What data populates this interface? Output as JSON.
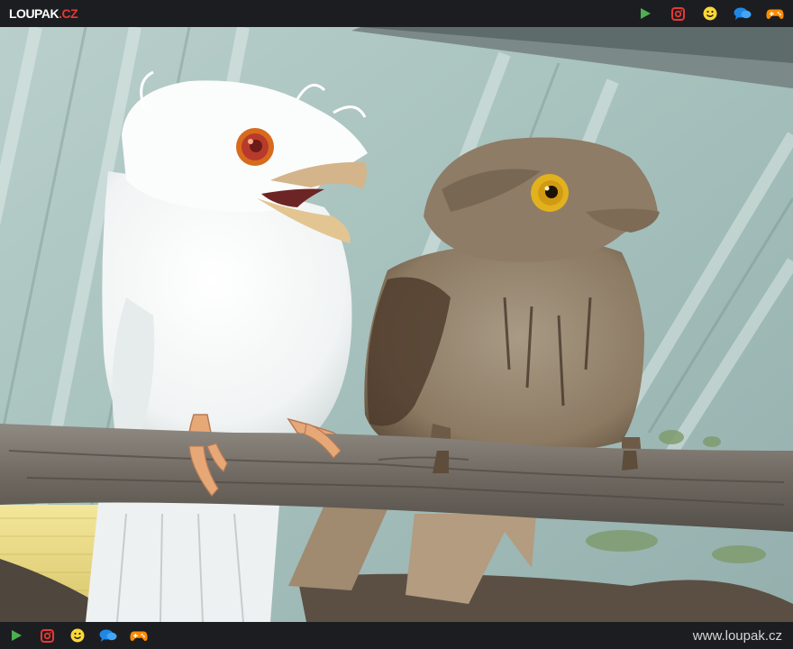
{
  "header": {
    "logo_text": "LOUPAK",
    "logo_tld": ".CZ",
    "icons": [
      "play-icon",
      "instagram-icon",
      "smiley-icon",
      "chat-bubbles-icon",
      "gamepad-icon"
    ]
  },
  "footer": {
    "icons": [
      "play-icon",
      "instagram-icon",
      "smiley-icon",
      "chat-bubbles-icon",
      "gamepad-icon"
    ],
    "url": "www.loupak.cz"
  },
  "photo": {
    "subject": "white frogmouth and brown frogmouth perched on a branch"
  },
  "colors": {
    "bar_bg": "#1c1d21",
    "play": "#4caf50",
    "instagram": "#e53935",
    "smiley": "#fdd835",
    "chat": "#1e88e5",
    "gamepad": "#fb8c00"
  }
}
